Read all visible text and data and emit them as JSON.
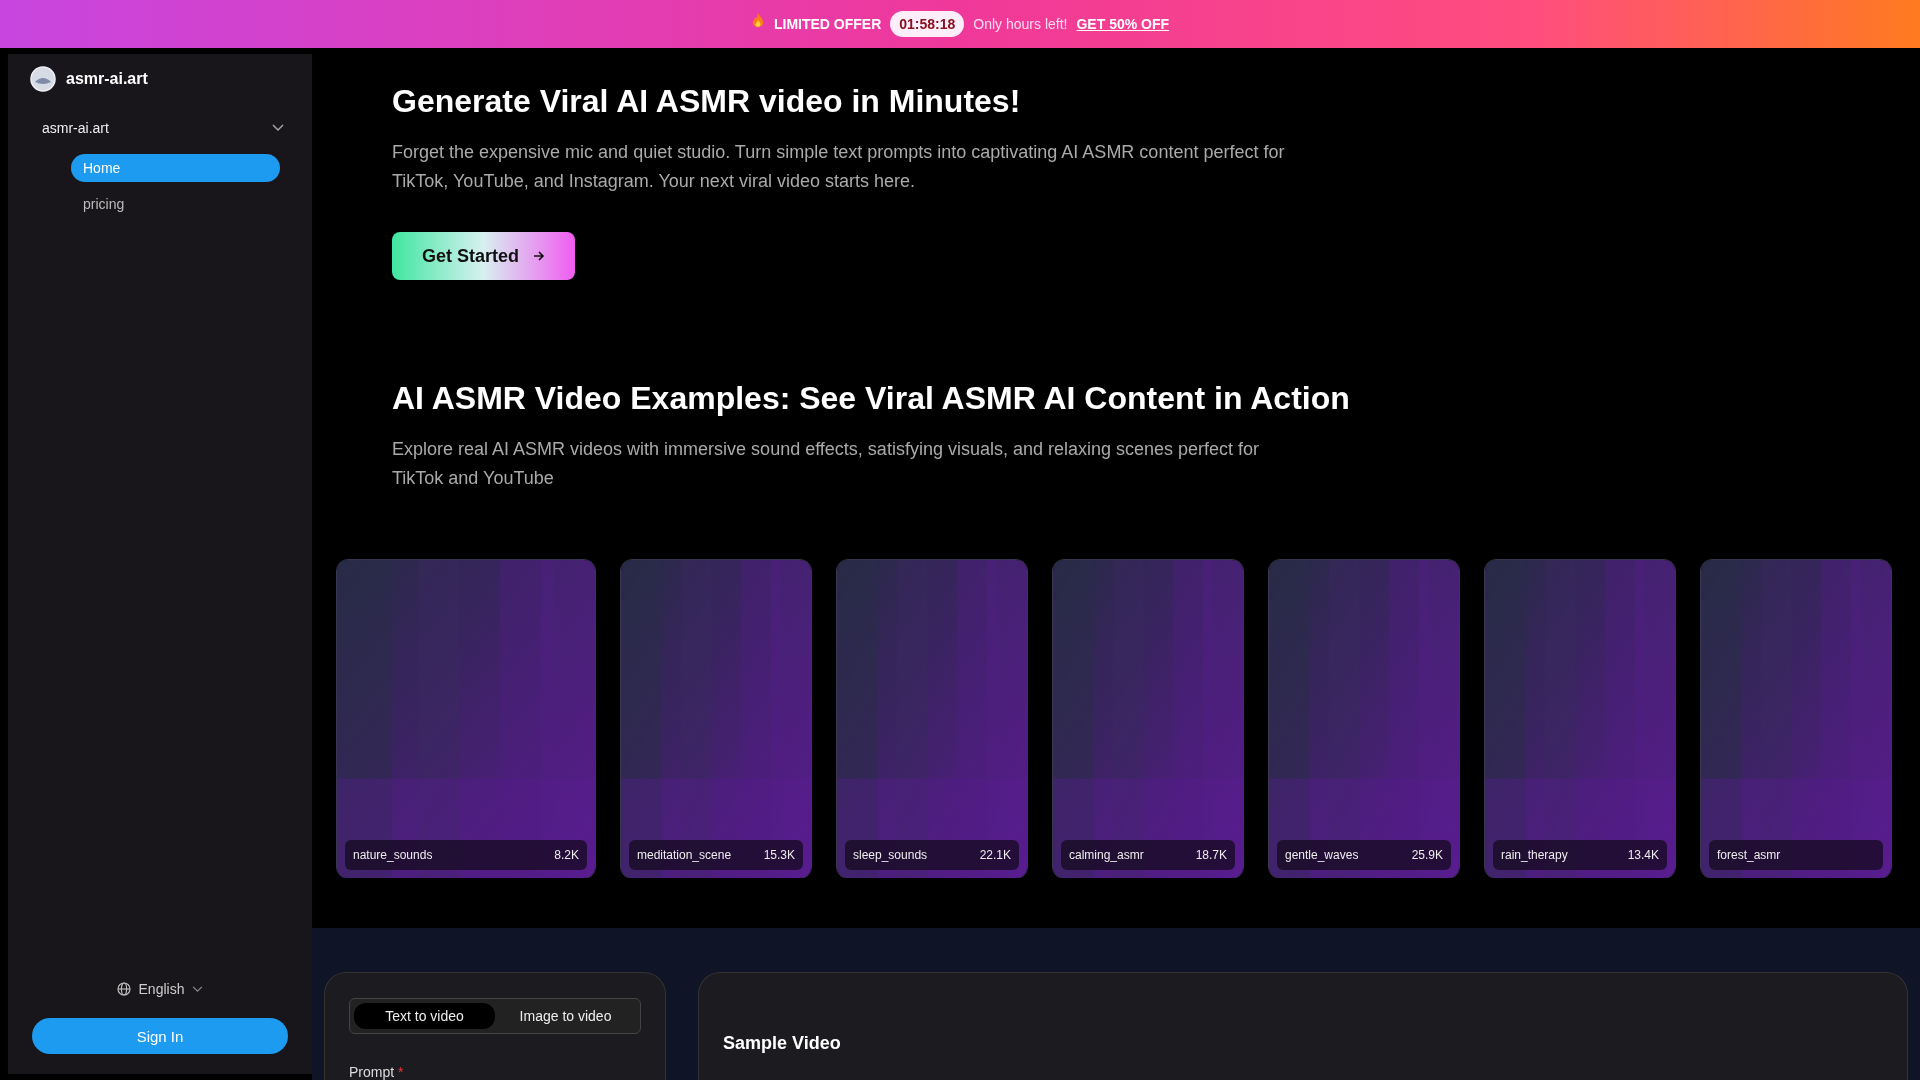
{
  "banner": {
    "label": "LIMITED OFFER",
    "timer": "01:58:18",
    "note": "Only hours left!",
    "link": "GET 50% OFF"
  },
  "sidebar": {
    "brand": "asmr-ai.art",
    "group": {
      "label": "asmr-ai.art",
      "expanded": true,
      "items": [
        {
          "label": "Home",
          "selected": true
        },
        {
          "label": "pricing",
          "selected": false
        }
      ]
    },
    "language": "English",
    "sign_in": "Sign In"
  },
  "hero": {
    "title": "Generate Viral AI ASMR video in Minutes!",
    "text": "Forget the expensive mic and quiet studio. Turn simple text prompts into captivating AI ASMR content perfect for TikTok, YouTube, and Instagram. Your next viral video starts here.",
    "button": "Get Started"
  },
  "examples": {
    "title": "AI ASMR Video Examples: See Viral ASMR AI Content in Action",
    "text": "Explore real AI ASMR videos with immersive sound effects, satisfying visuals, and relaxing scenes perfect for TikTok and YouTube",
    "videos": [
      {
        "name": "nature_sounds",
        "views": "8.2K"
      },
      {
        "name": "meditation_scene",
        "views": "15.3K"
      },
      {
        "name": "sleep_sounds",
        "views": "22.1K"
      },
      {
        "name": "calming_asmr",
        "views": "18.7K"
      },
      {
        "name": "gentle_waves",
        "views": "25.9K"
      },
      {
        "name": "rain_therapy",
        "views": "13.4K"
      },
      {
        "name": "forest_asmr"
      }
    ]
  },
  "generator": {
    "tabs": [
      {
        "label": "Text to video",
        "selected": true
      },
      {
        "label": "Image to video",
        "selected": false
      }
    ],
    "prompt_label": "Prompt",
    "required": "*",
    "sample_title": "Sample Video"
  }
}
